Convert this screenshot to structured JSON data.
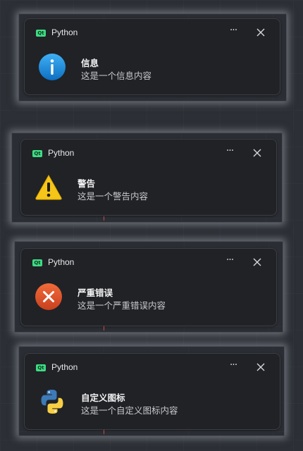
{
  "toasts": [
    {
      "app_name": "Python",
      "badge": "Qt",
      "title": "信息",
      "content": "这是一个信息内容",
      "icon": "info-icon",
      "color": "#1a8fe0"
    },
    {
      "app_name": "Python",
      "badge": "Qt",
      "title": "警告",
      "content": "这是一个警告内容",
      "icon": "warning-icon",
      "color": "#f5c518"
    },
    {
      "app_name": "Python",
      "badge": "Qt",
      "title": "严重错误",
      "content": "这是一个严重错误内容",
      "icon": "error-icon",
      "color": "#e4572e"
    },
    {
      "app_name": "Python",
      "badge": "Qt",
      "title": "自定义图标",
      "content": "这是一个自定义图标内容",
      "icon": "python-logo-icon",
      "color": "#3d7ab8"
    }
  ],
  "more_label": "···"
}
